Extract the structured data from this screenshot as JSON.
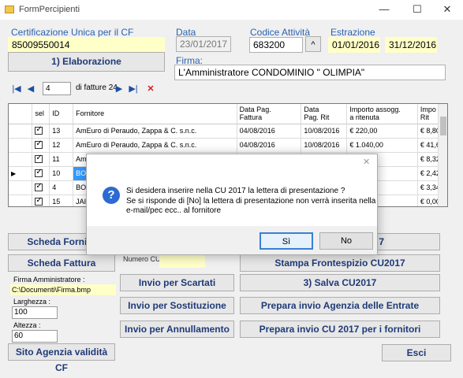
{
  "window": {
    "title": "FormPercipienti",
    "minimize": "—",
    "maximize": "☐",
    "close": "✕"
  },
  "cf": {
    "label": "Certificazione Unica per il CF",
    "value": "85009550014"
  },
  "data": {
    "label": "Data",
    "value": "23/01/2017"
  },
  "codice": {
    "label": "Codice Attività",
    "value": "683200",
    "dropdown": "^"
  },
  "estrazione": {
    "label": "Estrazione",
    "from": "01/01/2016",
    "to": "31/12/2016"
  },
  "elaborazione_btn": "1) Elaborazione",
  "firma": {
    "label": "Firma:",
    "value": "L'Amministratore CONDOMINIO \" OLIMPIA\""
  },
  "nav": {
    "first": "|◀",
    "prev": "◀",
    "position": "4",
    "of_label": "di fatture 24",
    "next": "▶",
    "last": "▶|",
    "delete": "✕"
  },
  "grid": {
    "columns": [
      "",
      "sel",
      "ID",
      "Fornitore",
      "Data Pag.\nFattura",
      "Data\nPag. Rit",
      "Importo assogg.\na ritenuta",
      "Impo\nRit"
    ],
    "rows": [
      {
        "marker": "",
        "id": "13",
        "fornitore": "AmEuro di Peraudo, Zappa & C. s.n.c.",
        "data_fatt": "04/08/2016",
        "data_rit": "10/08/2016",
        "importo": "€ 220,00",
        "rit": "€ 8,80"
      },
      {
        "marker": "",
        "id": "12",
        "fornitore": "AmEuro di Peraudo, Zappa & C. s.n.c.",
        "data_fatt": "04/08/2016",
        "data_rit": "10/08/2016",
        "importo": "€ 1.040,00",
        "rit": "€ 41,60"
      },
      {
        "marker": "",
        "id": "11",
        "fornitore": "Am",
        "data_fatt": "",
        "data_rit": "",
        "importo": "",
        "rit": "€ 8,32"
      },
      {
        "marker": "▶",
        "id": "10",
        "fornitore": "BO",
        "data_fatt": "",
        "data_rit": "",
        "importo": "",
        "rit": "€ 2,42"
      },
      {
        "marker": "",
        "id": "4",
        "fornitore": "BO",
        "data_fatt": "",
        "data_rit": "",
        "importo": "",
        "rit": "€ 3,34"
      },
      {
        "marker": "",
        "id": "15",
        "fornitore": "JAI",
        "data_fatt": "",
        "data_rit": "",
        "importo": "",
        "rit": "€ 0,00"
      }
    ]
  },
  "buttons": {
    "scheda_fornitore": "Scheda Fornito",
    "scheda_fattura": "Scheda Fattura",
    "right_top": "7",
    "stampa_frontespizio": "Stampa Frontespizio CU2017",
    "invio_scartati": "Invio per Scartati",
    "salva": "3) Salva CU2017",
    "invio_sostituzione": "Invio per Sostituzione",
    "prepara_agenzia": "Prepara  invio Agenzia delle Entrate",
    "invio_annullamento": "Invio per Annullamento",
    "prepara_fornitori": "Prepara invio CU 2017 per i fornitori",
    "sito_agenzia": "Sito Agenzia validità CF",
    "esci": "Esci"
  },
  "numero_cu": {
    "label": "Numero CU"
  },
  "firma_amm": {
    "label": "Firma Amministratore :",
    "value": "C:\\Documenti\\Firma.bmp"
  },
  "larghezza": {
    "label": "Larghezza :",
    "value": "100"
  },
  "altezza": {
    "label": "Altezza :",
    "value": "60"
  },
  "dialog": {
    "close": "✕",
    "icon": "?",
    "line1": "Si desidera inserire nella CU 2017 la lettera di presentazione ?",
    "line2": "Se si risponde di [No] la lettera di presentazione non verrà inserita nella",
    "line3": "e-mail/pec ecc..  al fornitore",
    "yes": "Sì",
    "no": "No"
  }
}
